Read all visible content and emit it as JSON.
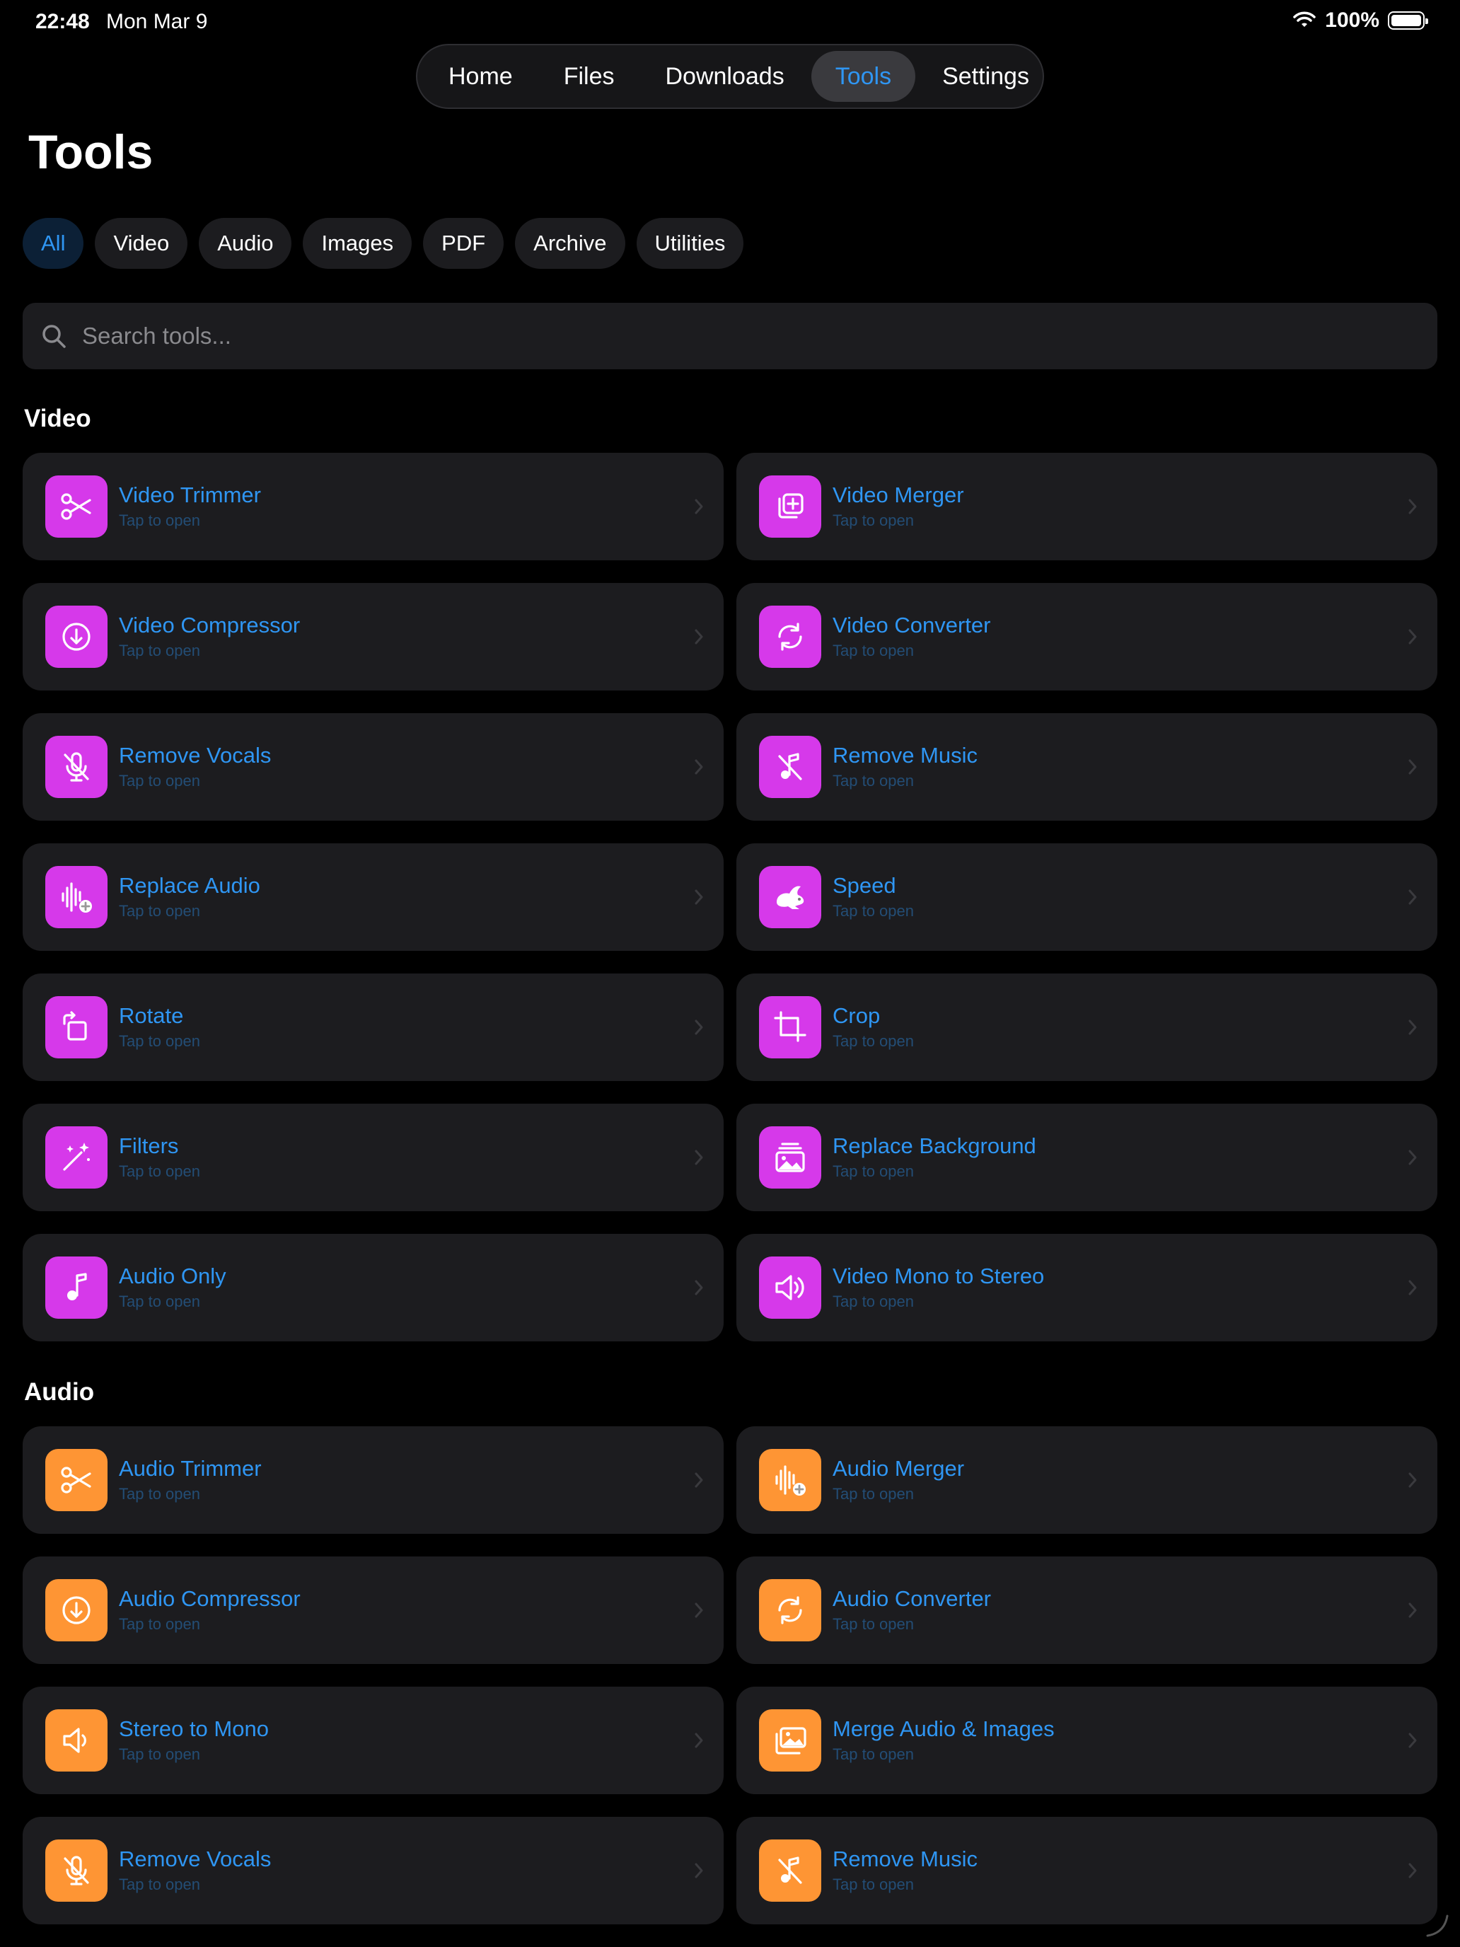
{
  "status_bar": {
    "time": "22:48",
    "date": "Mon Mar 9",
    "battery": "100%"
  },
  "nav": {
    "tabs": [
      "Home",
      "Files",
      "Downloads",
      "Tools",
      "Settings"
    ],
    "active": "Tools"
  },
  "page_title": "Tools",
  "filters": [
    "All",
    "Video",
    "Audio",
    "Images",
    "PDF",
    "Archive",
    "Utilities"
  ],
  "active_filter": "All",
  "search": {
    "placeholder": "Search tools..."
  },
  "colors": {
    "accent": "#2f96f3",
    "video_icon_bg": "#d639ea",
    "audio_icon_bg": "#fe9534",
    "card_bg": "#1c1c1f"
  },
  "sections": [
    {
      "title": "Video",
      "tools": [
        {
          "title": "Video Trimmer",
          "subtitle": "Tap to open",
          "icon": "scissors-icon"
        },
        {
          "title": "Video Merger",
          "subtitle": "Tap to open",
          "icon": "plus-stack-icon"
        },
        {
          "title": "Video Compressor",
          "subtitle": "Tap to open",
          "icon": "arrow-down-circle-icon"
        },
        {
          "title": "Video Converter",
          "subtitle": "Tap to open",
          "icon": "convert-arrows-icon"
        },
        {
          "title": "Remove Vocals",
          "subtitle": "Tap to open",
          "icon": "mic-slash-icon"
        },
        {
          "title": "Remove Music",
          "subtitle": "Tap to open",
          "icon": "music-note-slash-icon"
        },
        {
          "title": "Replace Audio",
          "subtitle": "Tap to open",
          "icon": "waveform-plus-icon"
        },
        {
          "title": "Speed",
          "subtitle": "Tap to open",
          "icon": "hare-icon"
        },
        {
          "title": "Rotate",
          "subtitle": "Tap to open",
          "icon": "rotate-icon"
        },
        {
          "title": "Crop",
          "subtitle": "Tap to open",
          "icon": "crop-icon"
        },
        {
          "title": "Filters",
          "subtitle": "Tap to open",
          "icon": "magic-wand-icon"
        },
        {
          "title": "Replace Background",
          "subtitle": "Tap to open",
          "icon": "photo-stack-icon"
        },
        {
          "title": "Audio Only",
          "subtitle": "Tap to open",
          "icon": "music-note-icon"
        },
        {
          "title": "Video Mono to Stereo",
          "subtitle": "Tap to open",
          "icon": "speaker-wave-icon"
        }
      ]
    },
    {
      "title": "Audio",
      "tools": [
        {
          "title": "Audio Trimmer",
          "subtitle": "Tap to open",
          "icon": "scissors-icon"
        },
        {
          "title": "Audio Merger",
          "subtitle": "Tap to open",
          "icon": "waveform-plus-icon"
        },
        {
          "title": "Audio Compressor",
          "subtitle": "Tap to open",
          "icon": "arrow-down-circle-icon"
        },
        {
          "title": "Audio Converter",
          "subtitle": "Tap to open",
          "icon": "convert-arrows-icon"
        },
        {
          "title": "Stereo to Mono",
          "subtitle": "Tap to open",
          "icon": "speaker-icon"
        },
        {
          "title": "Merge Audio & Images",
          "subtitle": "Tap to open",
          "icon": "photos-icon"
        },
        {
          "title": "Remove Vocals",
          "subtitle": "Tap to open",
          "icon": "mic-slash-icon"
        },
        {
          "title": "Remove Music",
          "subtitle": "Tap to open",
          "icon": "music-note-slash-icon"
        }
      ]
    }
  ]
}
